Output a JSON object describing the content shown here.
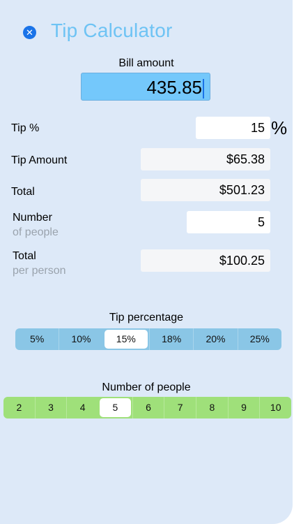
{
  "header": {
    "close_icon": "close-icon",
    "title": "Tip Calculator"
  },
  "bill": {
    "label": "Bill amount",
    "value": "435.85"
  },
  "tip_percent": {
    "label": "Tip %",
    "value": "15",
    "symbol": "%"
  },
  "tip_amount": {
    "label": "Tip Amount",
    "value": "$65.38"
  },
  "total": {
    "label": "Total",
    "value": "$501.23"
  },
  "people": {
    "label": "Number",
    "sublabel": "of people",
    "value": "5"
  },
  "per_person": {
    "label": "Total",
    "sublabel": "per person",
    "value": "$100.25"
  },
  "tip_selector": {
    "label": "Tip percentage",
    "options": [
      "5%",
      "10%",
      "15%",
      "18%",
      "20%",
      "25%"
    ],
    "selected": "15%"
  },
  "people_selector": {
    "label": "Number of people",
    "options": [
      "2",
      "3",
      "4",
      "5",
      "6",
      "7",
      "8",
      "9",
      "10"
    ],
    "selected": "5"
  },
  "colors": {
    "background": "#dde9f8",
    "title": "#6ec3f4",
    "bill_field": "#74c8fb",
    "tip_segment": "#8ac6e6",
    "people_segment": "#9fe07a"
  }
}
